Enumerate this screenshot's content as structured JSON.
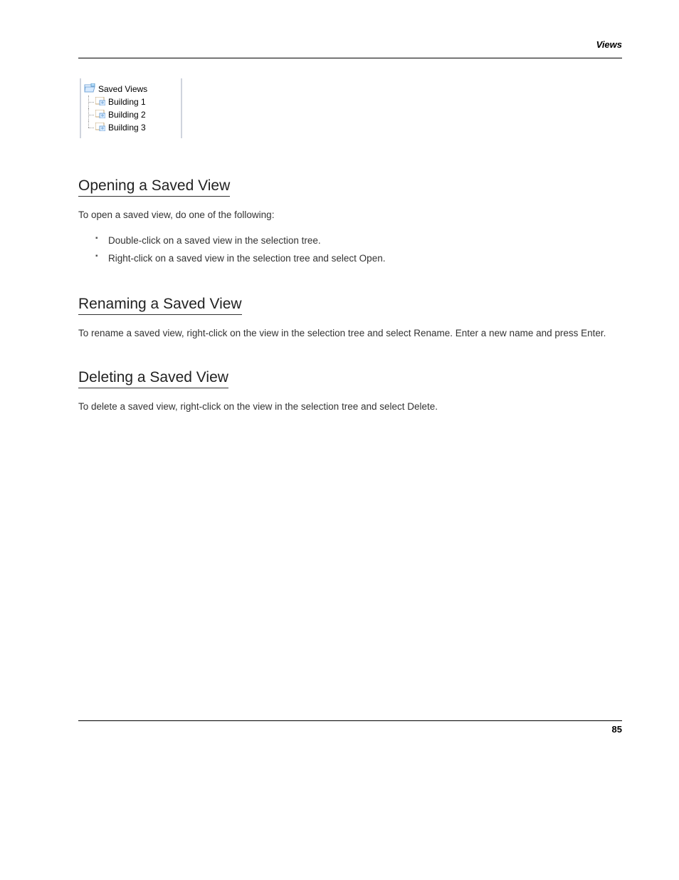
{
  "header": {
    "section_title": "Views"
  },
  "tree": {
    "root_label": "Saved Views",
    "children": [
      {
        "label": "Building 1"
      },
      {
        "label": "Building 2"
      },
      {
        "label": "Building 3"
      }
    ]
  },
  "sections": {
    "open": {
      "heading": "Opening a Saved View",
      "intro": "To open a saved view, do one of the following:",
      "bullets": [
        "Double-click on a saved view in the selection tree.",
        "Right-click on a saved view in the selection tree and select Open."
      ]
    },
    "rename": {
      "heading": "Renaming a Saved View",
      "body": "To rename a saved view, right-click on the view in the selection tree and select Rename. Enter a new name and press Enter."
    },
    "delete": {
      "heading": "Deleting a Saved View",
      "body": "To delete a saved view, right-click on the view in the selection tree and select Delete."
    }
  },
  "footer": {
    "page_number": "85"
  }
}
